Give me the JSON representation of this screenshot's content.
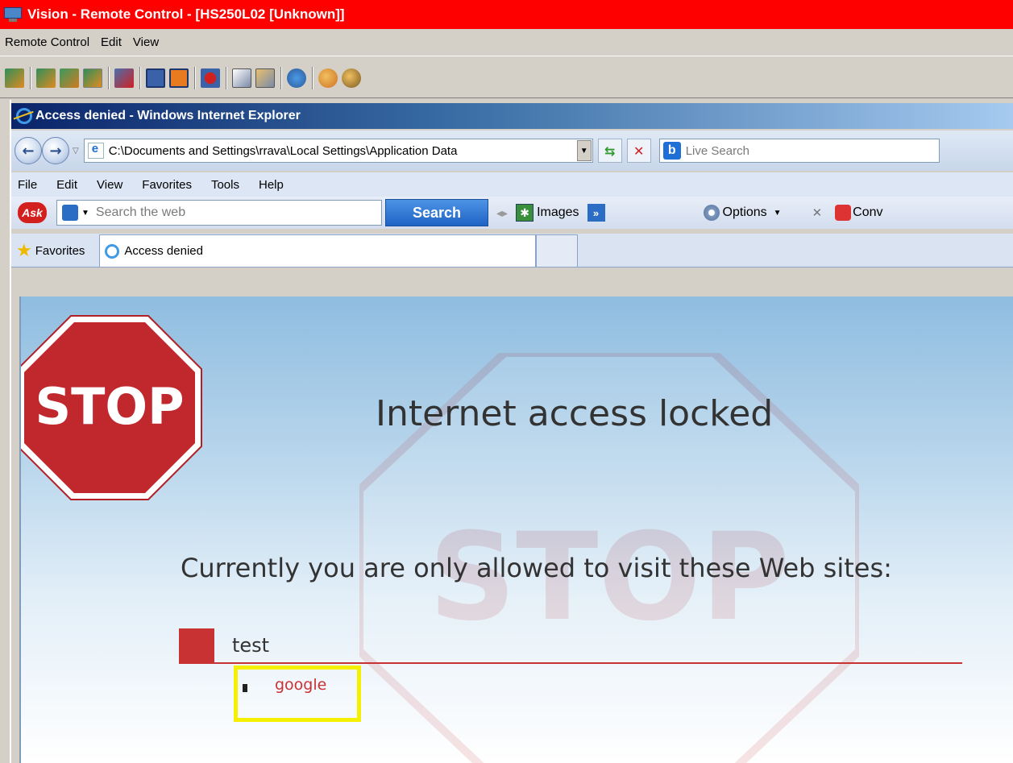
{
  "outer_window": {
    "title": "Vision - Remote Control - [HS250L02 [Unknown]]",
    "menu": [
      "Remote Control",
      "Edit",
      "View"
    ],
    "toolbar_icons": [
      "view-icon",
      "view-all-icon",
      "grid-icon",
      "pressed-icon",
      "disconnect-icon",
      "fullscreen-icon",
      "window-icon",
      "record-icon",
      "copy-icon",
      "paste-icon",
      "connect-icon",
      "chat-icon",
      "key-icon"
    ]
  },
  "ie": {
    "title": "Access denied - Windows Internet Explorer",
    "address": "C:\\Documents and Settings\\rrava\\Local Settings\\Application Data",
    "live_search_placeholder": "Live Search",
    "menu": [
      "File",
      "Edit",
      "View",
      "Favorites",
      "Tools",
      "Help"
    ],
    "ask": {
      "logo": "Ask",
      "placeholder": "Search the web",
      "search_label": "Search",
      "images_label": "Images",
      "options_label": "Options",
      "convert_label": "Conv"
    },
    "favorites_label": "Favorites",
    "tab_label": "Access denied"
  },
  "page": {
    "stop_text": "STOP",
    "headline": "Internet access locked",
    "subline": "Currently you are only allowed to visit these Web sites:",
    "category": "test",
    "site": "google"
  },
  "colors": {
    "outer_title_bg": "#ff0000",
    "stop_red": "#c0282d",
    "accent_red": "#c83232",
    "highlight_yellow": "#f5f000"
  }
}
